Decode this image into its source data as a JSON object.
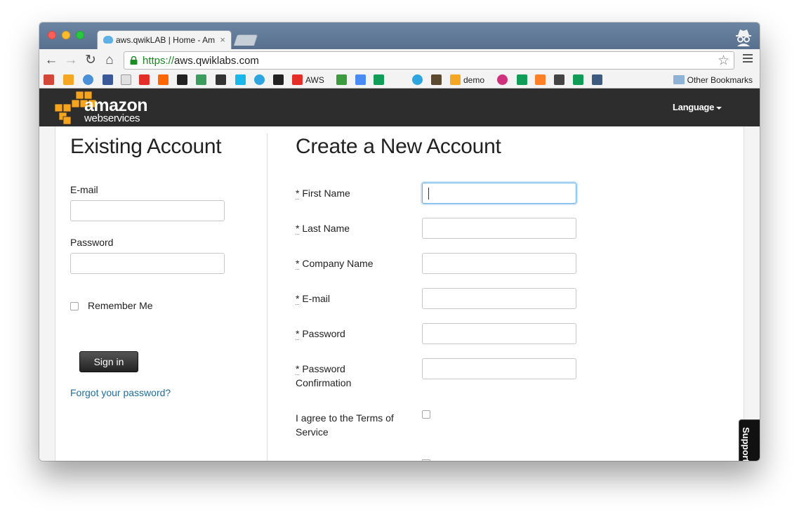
{
  "browser": {
    "tab_title": "aws.qwikLAB | Home - Am",
    "tab_close": "×",
    "url_scheme": "https://",
    "url_host": "aws.qwiklabs.com",
    "bookmarks": [
      {
        "icon": "gmail-icon",
        "label": ""
      },
      {
        "icon": "box-icon",
        "label": ""
      },
      {
        "icon": "chrome-icon",
        "label": ""
      },
      {
        "icon": "facebook-icon",
        "label": ""
      },
      {
        "icon": "page-icon",
        "label": ""
      },
      {
        "icon": "youtube-icon",
        "label": ""
      },
      {
        "icon": "ycombinator-icon",
        "label": ""
      },
      {
        "icon": "github-icon",
        "label": ""
      },
      {
        "icon": "coin-icon",
        "label": ""
      },
      {
        "icon": "ipt-icon",
        "label": ""
      },
      {
        "icon": "vimeo-icon",
        "label": ""
      },
      {
        "icon": "telegram-icon",
        "label": ""
      },
      {
        "icon": "flag-icon",
        "label": ""
      },
      {
        "icon": "youtube-icon",
        "label": "AWS"
      },
      {
        "icon": "windows-icon",
        "label": ""
      },
      {
        "icon": "translate-icon",
        "label": ""
      },
      {
        "icon": "sheet-icon",
        "label": ""
      },
      {
        "icon": "amazon-icon",
        "label": ""
      },
      {
        "icon": "telegram-icon",
        "label": ""
      },
      {
        "icon": "minecraft-icon",
        "label": ""
      },
      {
        "icon": "box-icon",
        "label": "demo"
      },
      {
        "icon": "chat-icon",
        "label": ""
      },
      {
        "icon": "sheet-icon",
        "label": ""
      },
      {
        "icon": "orange-icon",
        "label": ""
      },
      {
        "icon": "server-icon",
        "label": ""
      },
      {
        "icon": "sheet-icon",
        "label": ""
      },
      {
        "icon": "ca-icon",
        "label": ""
      }
    ],
    "other_bookmarks": "Other Bookmarks"
  },
  "header": {
    "logo_word": "amazon",
    "logo_sub": "webservices",
    "language": "Language"
  },
  "existing": {
    "title": "Existing Account",
    "email_label": "E-mail",
    "password_label": "Password",
    "remember_label": "Remember Me",
    "signin_label": "Sign in",
    "forgot_label": "Forgot your password?"
  },
  "create": {
    "title": "Create a New Account",
    "required_mark": "*",
    "first_name": "First Name",
    "last_name": "Last Name",
    "company_name": "Company Name",
    "email": "E-mail",
    "password": "Password",
    "password_conf_1": "Password",
    "password_conf_2": "Confirmation",
    "terms_1": "I agree to the Terms of",
    "terms_2": "Service"
  },
  "support": "Support",
  "colors": {
    "link": "#1e6f9f",
    "header_bg": "#2d2d2d",
    "aws_orange": "#f7a41d"
  }
}
